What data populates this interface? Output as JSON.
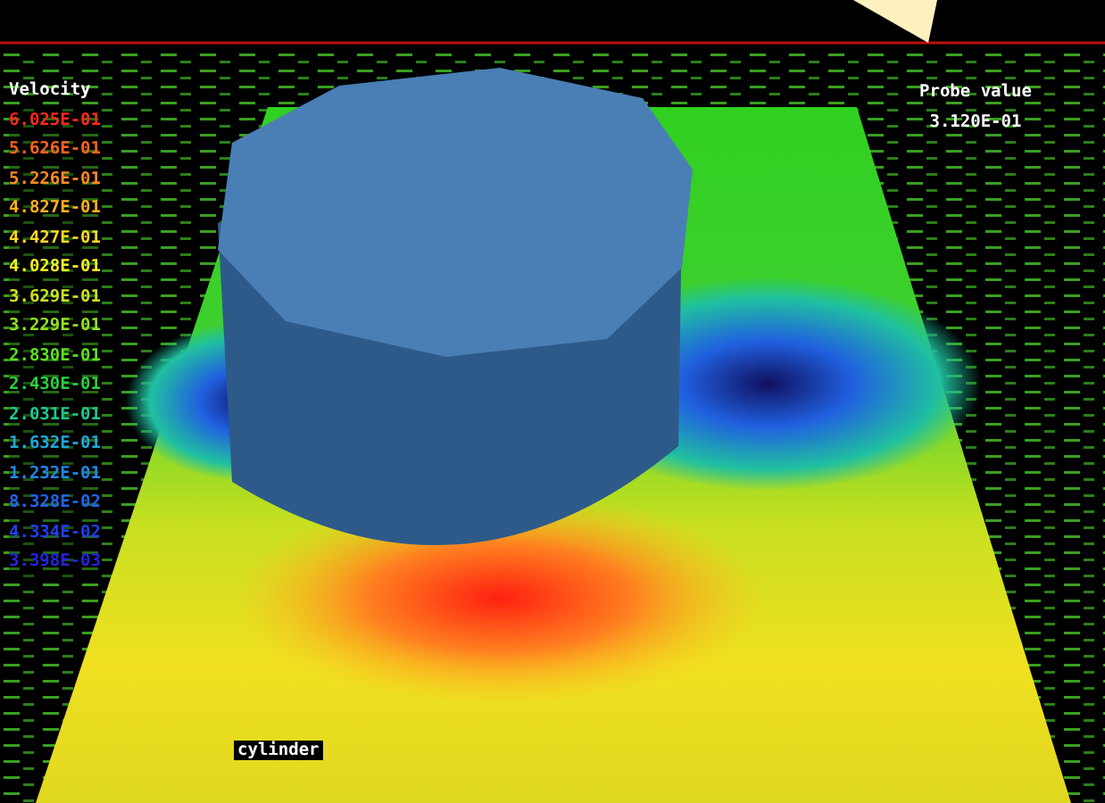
{
  "legend": {
    "title": "Velocity",
    "items": [
      {
        "value": "6.025E-01",
        "color": "#ff2a1a"
      },
      {
        "value": "5.626E-01",
        "color": "#ff6420"
      },
      {
        "value": "5.226E-01",
        "color": "#ff8a24"
      },
      {
        "value": "4.827E-01",
        "color": "#ffb020"
      },
      {
        "value": "4.427E-01",
        "color": "#ffd820"
      },
      {
        "value": "4.028E-01",
        "color": "#f4f020"
      },
      {
        "value": "3.629E-01",
        "color": "#cce020"
      },
      {
        "value": "3.229E-01",
        "color": "#94e020"
      },
      {
        "value": "2.830E-01",
        "color": "#5ce020"
      },
      {
        "value": "2.430E-01",
        "color": "#28d040"
      },
      {
        "value": "2.031E-01",
        "color": "#20c890"
      },
      {
        "value": "1.632E-01",
        "color": "#20a8d8"
      },
      {
        "value": "1.232E-01",
        "color": "#2088e8"
      },
      {
        "value": "8.328E-02",
        "color": "#2064f0"
      },
      {
        "value": "4.334E-02",
        "color": "#2040f0"
      },
      {
        "value": "3.398E-03",
        "color": "#2424e0"
      }
    ]
  },
  "probe": {
    "title": "Probe value",
    "value": "3.120E-01"
  },
  "object_label": "cylinder"
}
